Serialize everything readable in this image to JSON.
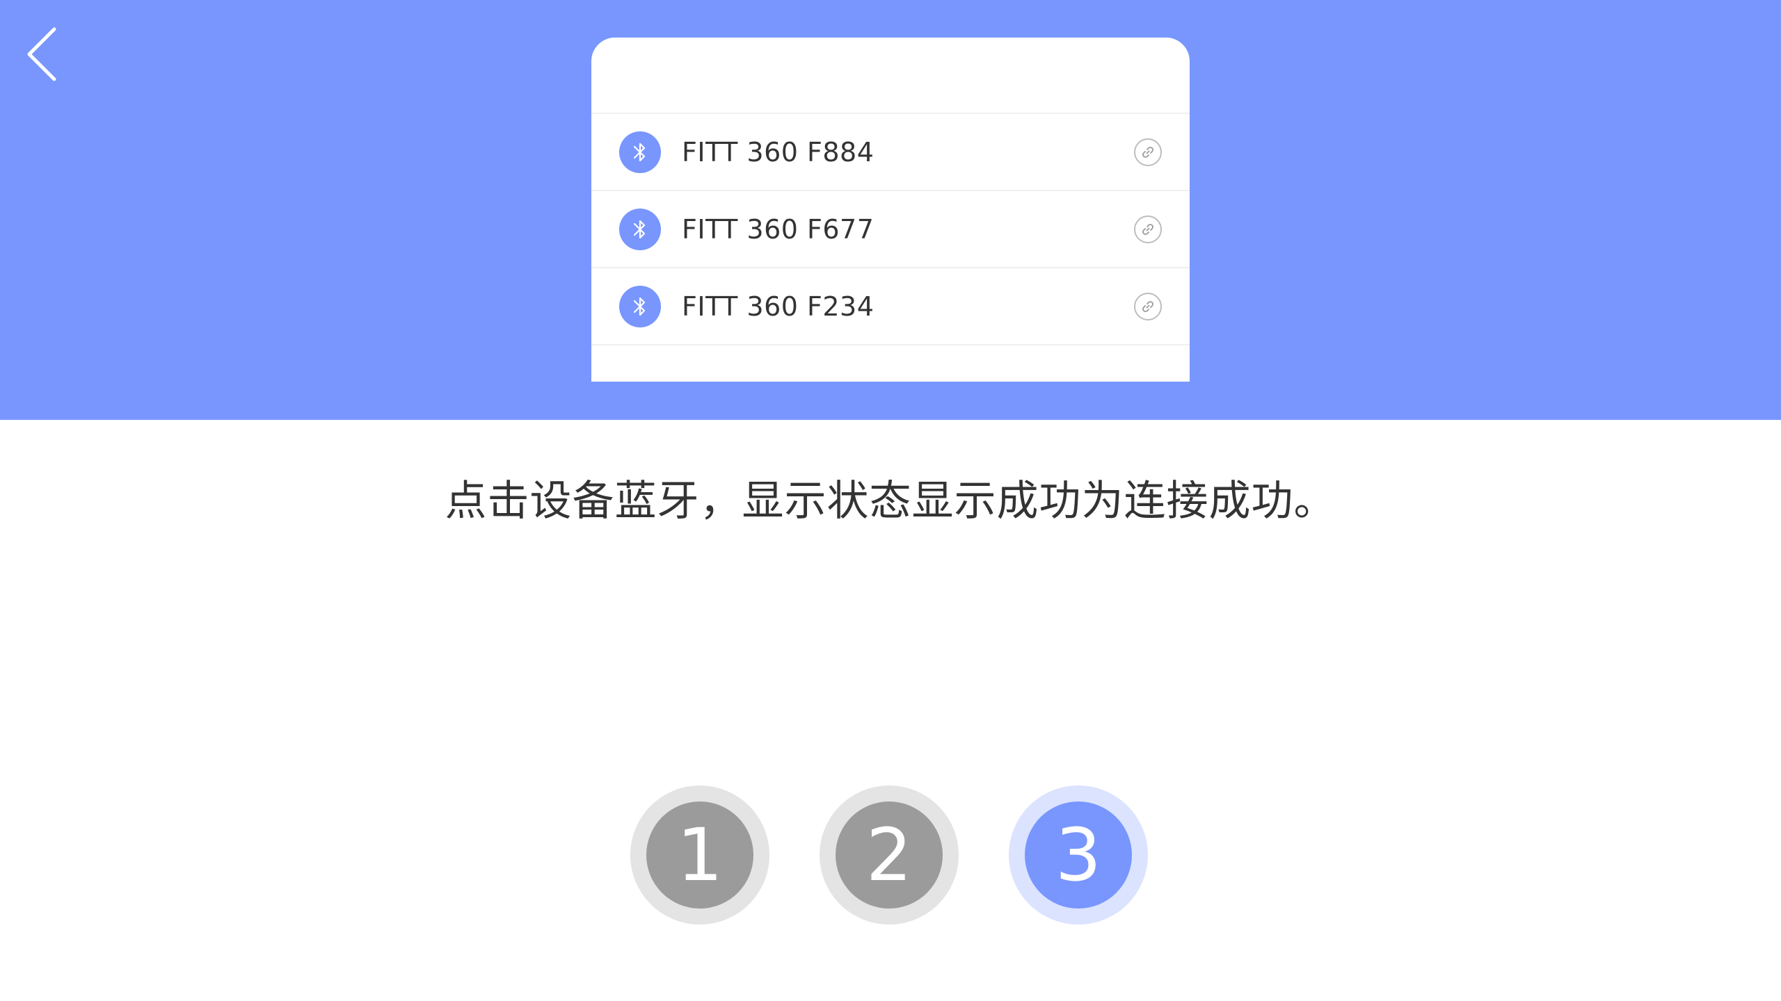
{
  "colors": {
    "primary": "#7896fe",
    "header_background": "#7896fe",
    "step_inactive": "#9b9b9b",
    "step_inactive_ring": "#e4e4e4",
    "step_active_ring": "#dbe3ff"
  },
  "header": {
    "back_icon": "chevron-left-icon"
  },
  "device_list": {
    "items": [
      {
        "name": "FITT 360 F884",
        "icon": "bluetooth-icon",
        "action_icon": "link-icon"
      },
      {
        "name": "FITT 360 F677",
        "icon": "bluetooth-icon",
        "action_icon": "link-icon"
      },
      {
        "name": "FITT 360 F234",
        "icon": "bluetooth-icon",
        "action_icon": "link-icon"
      }
    ]
  },
  "instruction": "点击设备蓝牙，显示状态显示成功为连接成功。",
  "steps": {
    "items": [
      {
        "label": "1",
        "active": false
      },
      {
        "label": "2",
        "active": false
      },
      {
        "label": "3",
        "active": true
      }
    ]
  }
}
